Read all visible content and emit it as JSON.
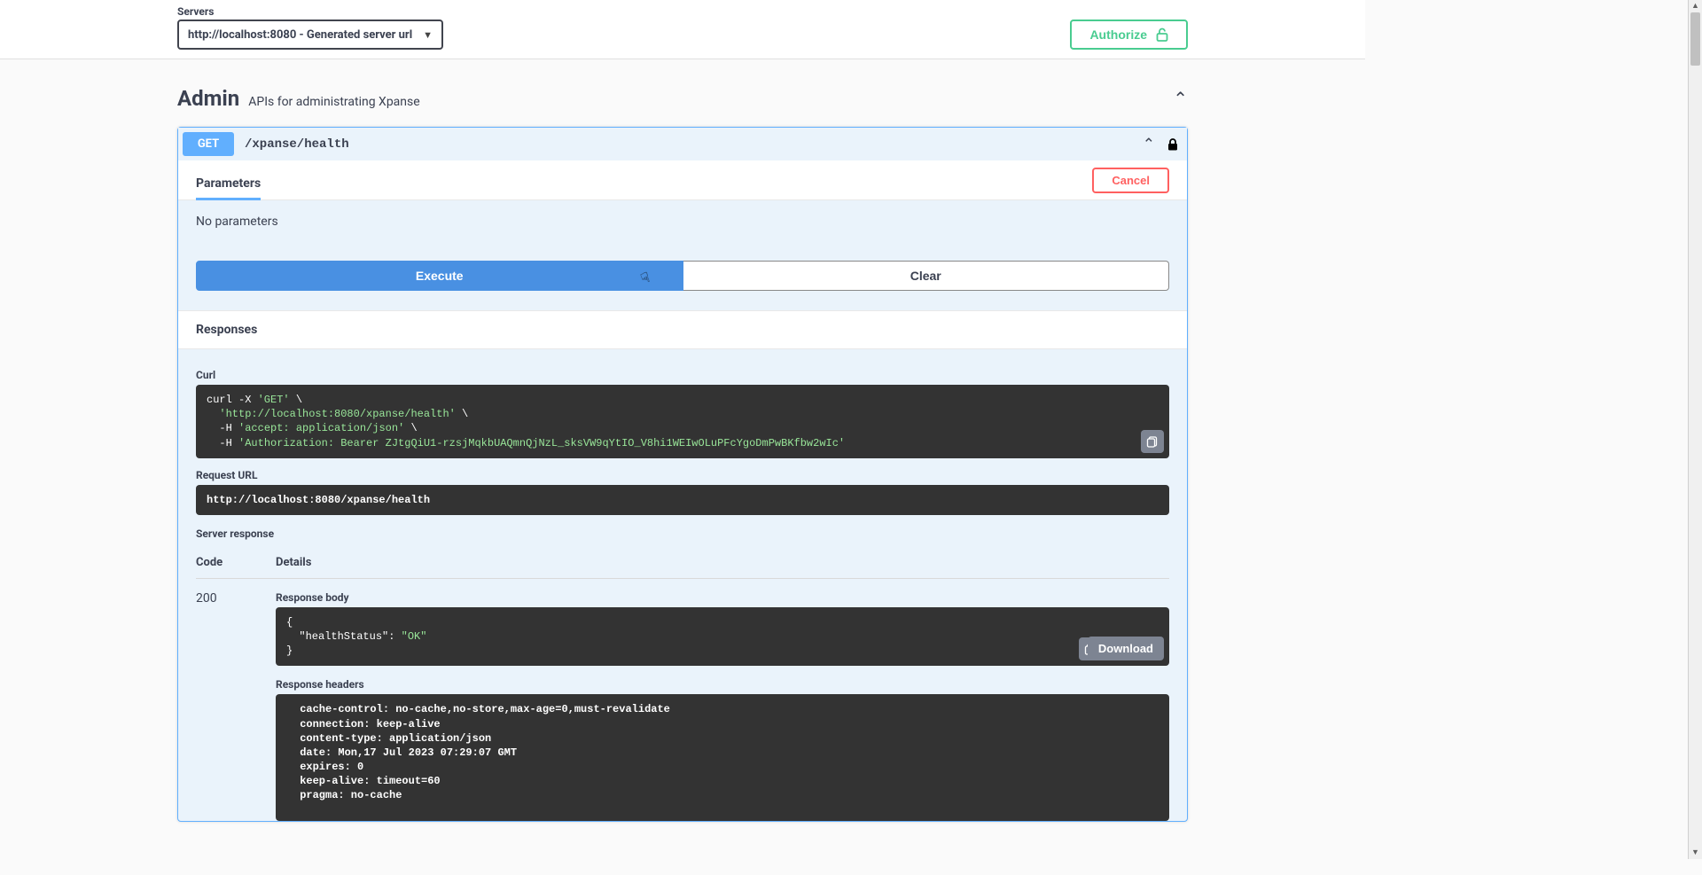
{
  "topbar": {
    "servers_label": "Servers",
    "server_selected": "http://localhost:8080 - Generated server url",
    "authorize_label": "Authorize"
  },
  "tag": {
    "name": "Admin",
    "description": "APIs for administrating Xpanse"
  },
  "operation": {
    "method": "GET",
    "path": "/xpanse/health"
  },
  "parameters": {
    "heading": "Parameters",
    "cancel_label": "Cancel",
    "no_params": "No parameters",
    "execute_label": "Execute",
    "clear_label": "Clear"
  },
  "responses": {
    "heading": "Responses",
    "curl_label": "Curl",
    "curl_command": {
      "l1a": "curl -X ",
      "l1b": "'GET'",
      "l1c": " \\",
      "l2a": "  ",
      "l2b": "'http://localhost:8080/xpanse/health'",
      "l2c": " \\",
      "l3a": "  -H ",
      "l3b": "'accept: application/json'",
      "l3c": " \\",
      "l4a": "  -H ",
      "l4b": "'Authorization: Bearer ZJtgQiU1-rzsjMqkbUAQmnQjNzL_sksVW9qYtIO_V8hi1WEIwOLuPFcYgoDmPwBKfbw2wIc'"
    },
    "request_url_label": "Request URL",
    "request_url": "http://localhost:8080/xpanse/health",
    "server_response_label": "Server response",
    "code_col": "Code",
    "details_col": "Details",
    "code": "200",
    "body_label": "Response body",
    "body_json": {
      "l1": "{",
      "l2a": "  \"healthStatus\": ",
      "l2b": "\"OK\"",
      "l3": "}"
    },
    "download_label": "Download",
    "headers_label": "Response headers",
    "headers_text": " cache-control: no-cache,no-store,max-age=0,must-revalidate \n connection: keep-alive \n content-type: application/json \n date: Mon,17 Jul 2023 07:29:07 GMT \n expires: 0 \n keep-alive: timeout=60 \n pragma: no-cache "
  }
}
